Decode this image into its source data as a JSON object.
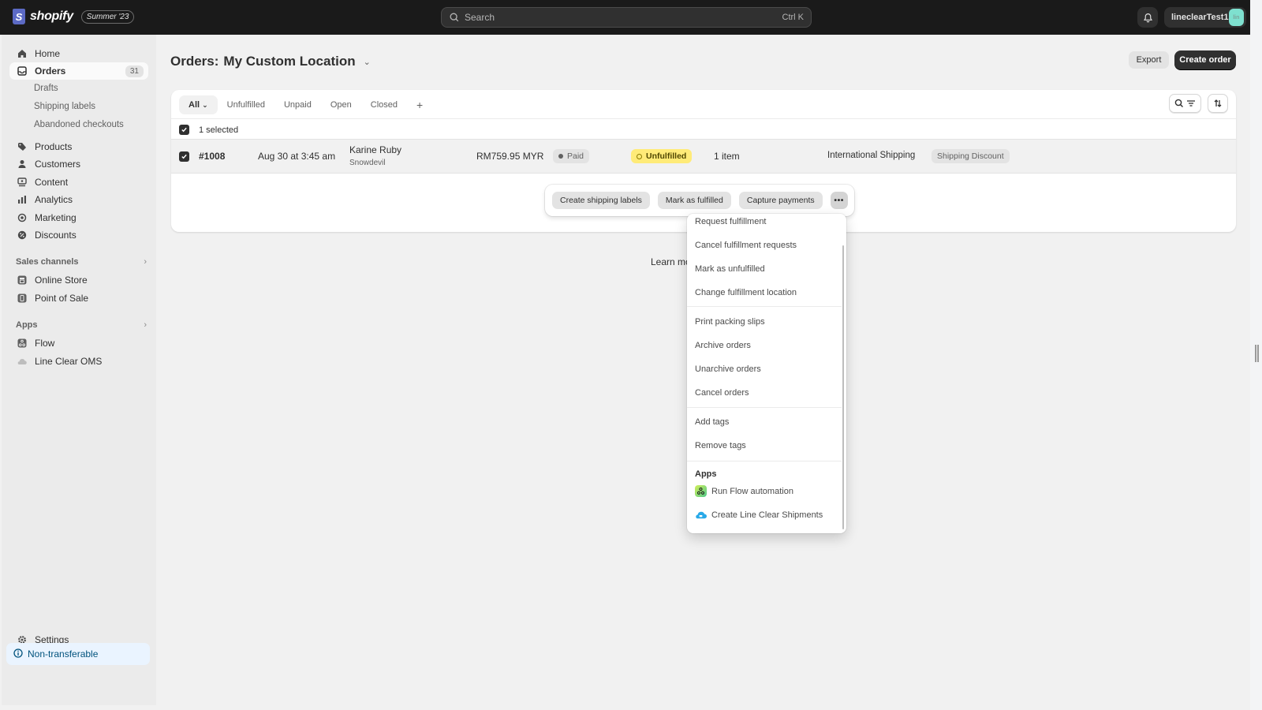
{
  "topbar": {
    "brand": "shopify",
    "brand_glyph": "S",
    "edition": "Summer '23",
    "search_placeholder": "Search",
    "search_shortcut": "Ctrl K",
    "username": "lineclearTest1",
    "avatar_initials": "lin"
  },
  "sidebar": {
    "items": [
      {
        "label": "Home",
        "icon": "home-icon"
      },
      {
        "label": "Orders",
        "icon": "inbox-icon",
        "badge": "31",
        "active": true
      },
      {
        "label": "Products",
        "icon": "tag-icon"
      },
      {
        "label": "Customers",
        "icon": "person-icon"
      },
      {
        "label": "Content",
        "icon": "content-icon"
      },
      {
        "label": "Analytics",
        "icon": "bar-chart-icon"
      },
      {
        "label": "Marketing",
        "icon": "target-icon"
      },
      {
        "label": "Discounts",
        "icon": "discount-icon"
      }
    ],
    "orders_sub": [
      "Drafts",
      "Shipping labels",
      "Abandoned checkouts"
    ],
    "sales_channels": {
      "heading": "Sales channels",
      "items": [
        {
          "label": "Online Store",
          "icon": "store-icon"
        },
        {
          "label": "Point of Sale",
          "icon": "pos-icon"
        }
      ]
    },
    "apps": {
      "heading": "Apps",
      "items": [
        {
          "label": "Flow",
          "icon": "flow-icon"
        },
        {
          "label": "Line Clear OMS",
          "icon": "cloud-icon"
        }
      ]
    },
    "settings": "Settings",
    "notice": "Non-transferable"
  },
  "main": {
    "title_prefix": "Orders:",
    "title_location": "My Custom Location",
    "export_label": "Export",
    "create_label": "Create order",
    "tabs": [
      {
        "label": "All",
        "active": true
      },
      {
        "label": "Unfulfilled"
      },
      {
        "label": "Unpaid"
      },
      {
        "label": "Open"
      },
      {
        "label": "Closed"
      },
      {
        "label": "+"
      }
    ],
    "selected_text": "1 selected",
    "order": {
      "id": "#1008",
      "date": "Aug 30 at 3:45 am",
      "customer": "Karine Ruby",
      "customer_sub": "Snowdevil",
      "total": "RM759.95 MYR",
      "payment_status": "Paid",
      "fulfillment_status": "Unfulfilled",
      "items": "1 item",
      "delivery_method": "International Shipping",
      "tag": "Shipping Discount"
    },
    "learn_more": "Learn mo",
    "colors": {
      "unfulfilled_bg": "#ffeb78",
      "notice_bg": "#eaf4ff",
      "topbar_bg": "#1a1a1a"
    }
  },
  "bulk_actions": {
    "buttons": [
      "Create shipping labels",
      "Mark as fulfilled",
      "Capture payments"
    ],
    "more_label": "•••"
  },
  "menu": {
    "group1": [
      "Request fulfillment",
      "Cancel fulfillment requests",
      "Mark as unfulfilled",
      "Change fulfillment location"
    ],
    "group2": [
      "Print packing slips",
      "Archive orders",
      "Unarchive orders",
      "Cancel orders"
    ],
    "group3": [
      "Add tags",
      "Remove tags"
    ],
    "apps_heading": "Apps",
    "apps": [
      {
        "label": "Run Flow automation",
        "icon": "flow-app-icon"
      },
      {
        "label": "Create Line Clear Shipments",
        "icon": "line-clear-app-icon"
      }
    ]
  }
}
